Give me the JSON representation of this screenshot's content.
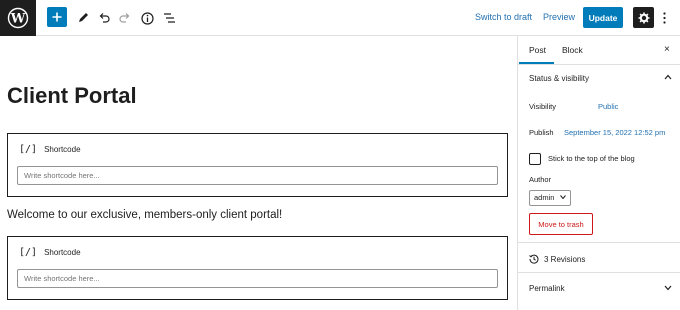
{
  "toolbar": {
    "switch_to_draft": "Switch to draft",
    "preview": "Preview",
    "update": "Update"
  },
  "editor": {
    "title": "Client Portal",
    "blocks": [
      {
        "type": "shortcode",
        "label": "Shortcode",
        "icon": "[/]",
        "placeholder": "Write shortcode here..."
      },
      {
        "type": "paragraph",
        "text": "Welcome to our exclusive, members-only client portal!"
      },
      {
        "type": "shortcode",
        "label": "Shortcode",
        "icon": "[/]",
        "placeholder": "Write shortcode here..."
      }
    ]
  },
  "sidebar": {
    "tabs": [
      "Post",
      "Block"
    ],
    "active_tab": "Post",
    "close": "×",
    "status_visibility": {
      "title": "Status & visibility",
      "visibility_label": "Visibility",
      "visibility_value": "Public",
      "publish_label": "Publish",
      "publish_value": "September 15, 2022 12:52 pm",
      "sticky_label": "Stick to the top of the blog",
      "sticky_checked": false,
      "author_label": "Author",
      "author_value": "admin",
      "trash_label": "Move to trash"
    },
    "revisions": "3 Revisions",
    "permalink": "Permalink"
  },
  "colors": {
    "accent": "#007cba",
    "link": "#2271b1",
    "danger": "#cc1818",
    "dark": "#1e1e1e"
  }
}
